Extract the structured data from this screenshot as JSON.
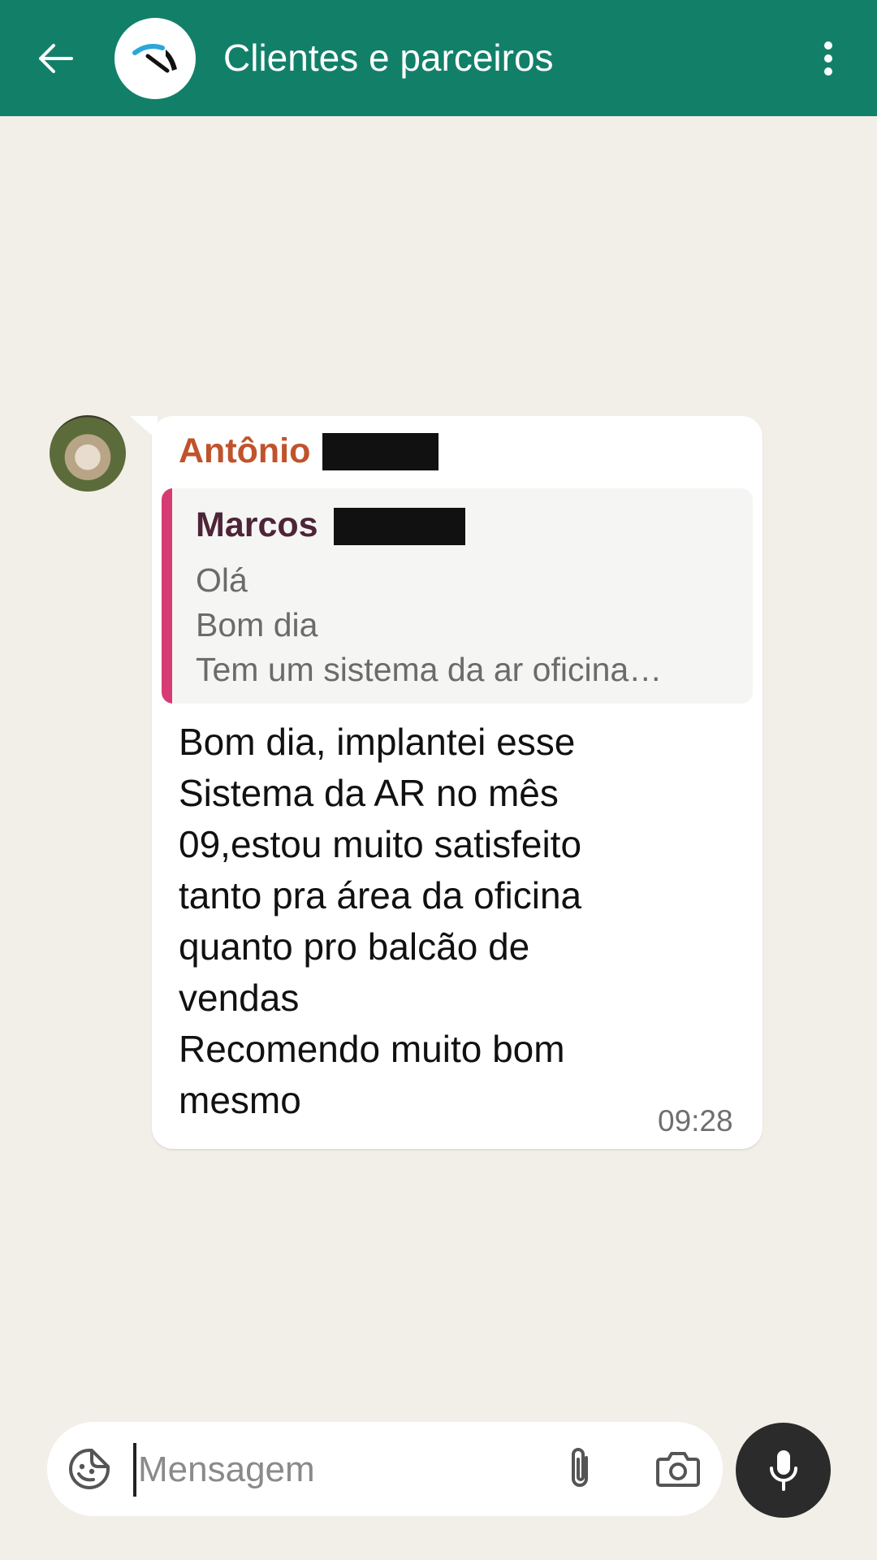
{
  "header": {
    "title": "Clientes e parceiros",
    "back_icon": "arrow-left-icon",
    "avatar_icon": "speedometer-logo-icon",
    "menu_icon": "more-vertical-icon",
    "background_color": "#128069"
  },
  "message": {
    "sender_name": "Antônio",
    "sender_color": "#c0532b",
    "quoted": {
      "author": "Marcos",
      "lines": [
        "Olá",
        "Bom dia",
        "Tem um sistema da ar oficina…"
      ],
      "accent_color": "#d63b74"
    },
    "body_lines": [
      "Bom dia, implantei esse",
      "Sistema da AR no mês",
      "09,estou muito satisfeito",
      "tanto pra área da oficina",
      "quanto pro balcão de",
      "vendas",
      "Recomendo muito bom",
      "mesmo"
    ],
    "time": "09:28"
  },
  "composer": {
    "placeholder": "Mensagem",
    "emoji_icon": "sticker-emoji-icon",
    "attach_icon": "paperclip-icon",
    "camera_icon": "camera-icon",
    "mic_icon": "microphone-icon"
  }
}
